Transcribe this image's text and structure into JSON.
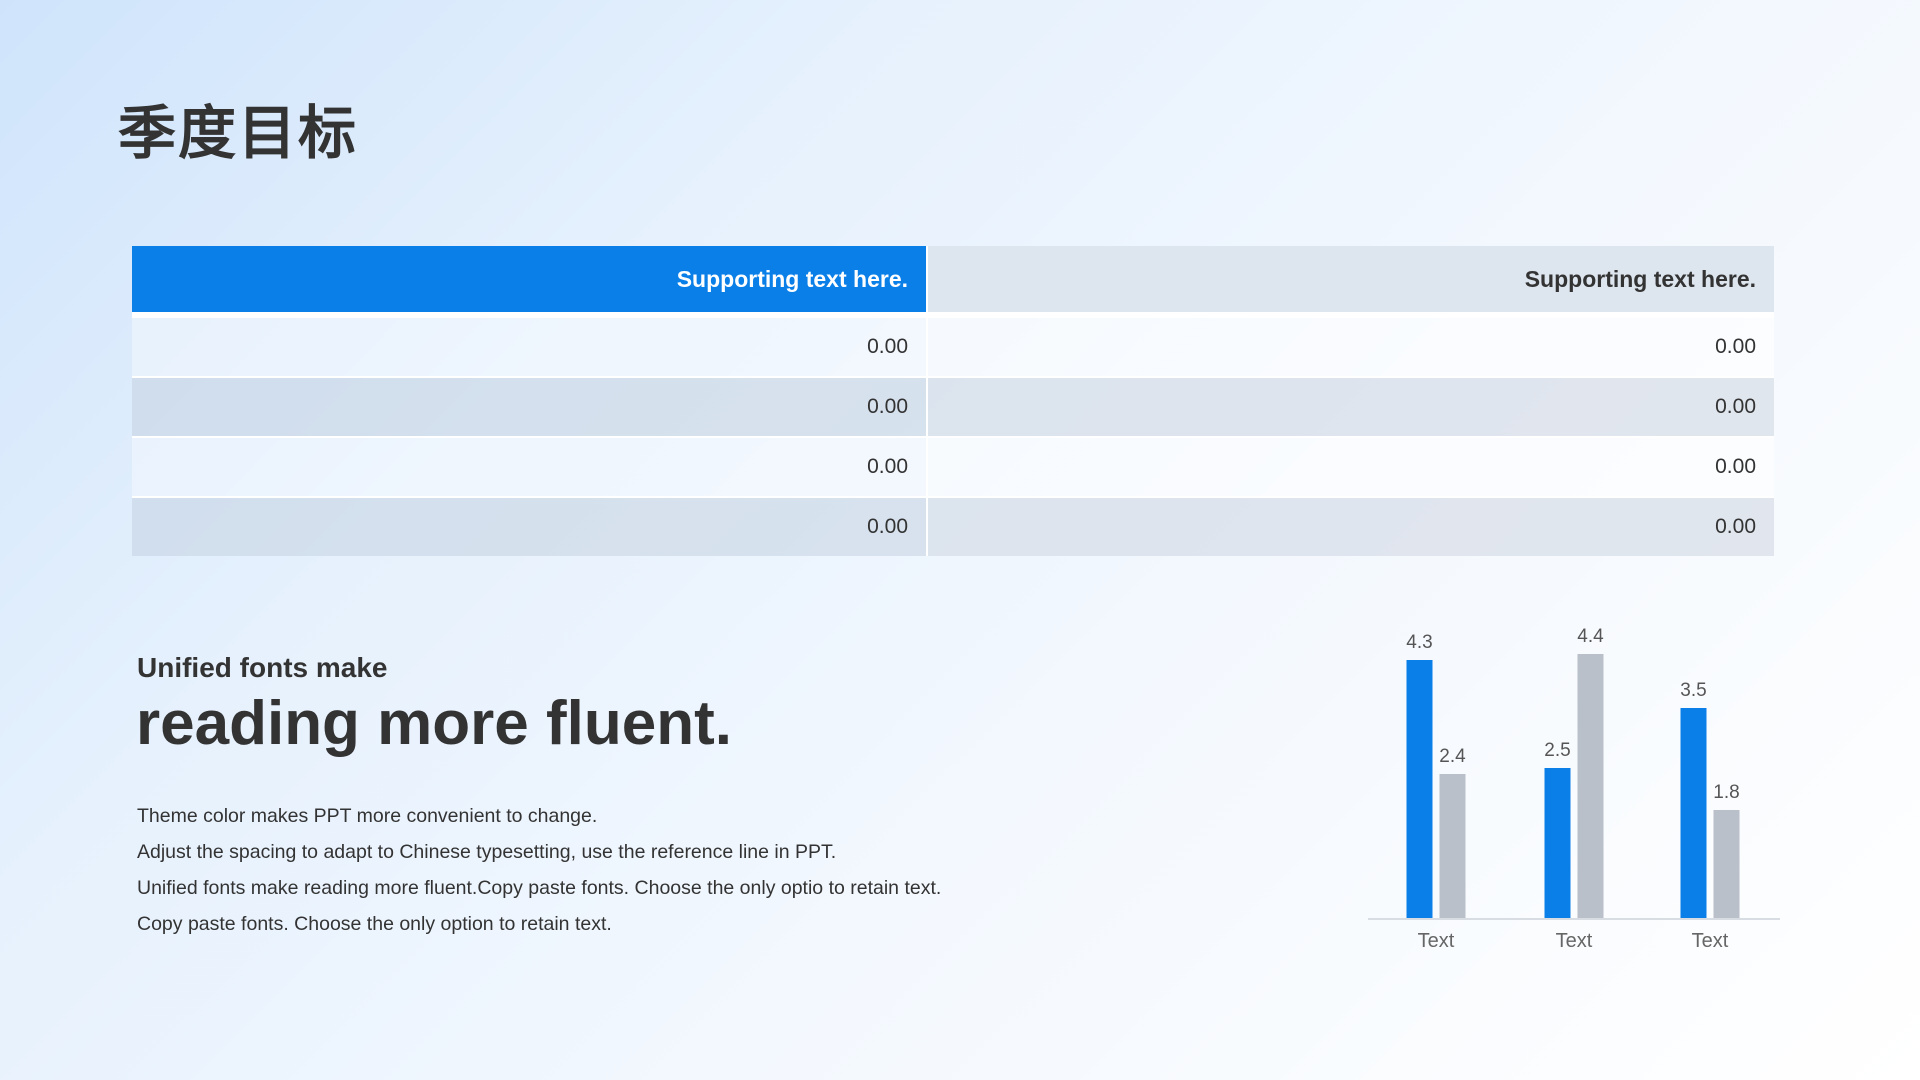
{
  "title": "季度目标",
  "table": {
    "headers": [
      "Supporting text here.",
      "Supporting text here."
    ],
    "rows": [
      [
        "0.00",
        "0.00"
      ],
      [
        "0.00",
        "0.00"
      ],
      [
        "0.00",
        "0.00"
      ],
      [
        "0.00",
        "0.00"
      ]
    ]
  },
  "text_block": {
    "subhead": "Unified fonts make",
    "headline": "reading more fluent.",
    "lines": [
      "Theme  color makes  PPT more convenient  to change.",
      "Adjust  the spacing  to adapt to Chinese  typesetting,  use  the reference line  in  PPT.",
      "Unified  fonts make reading more fluent.Copy paste fonts. Choose the only optio to retain text.",
      "Copy paste  fonts. Choose the only option to retain text."
    ]
  },
  "colors": {
    "accent": "#0a7fe8",
    "secondary": "#b9c0c9"
  },
  "chart_data": {
    "type": "bar",
    "categories": [
      "Text",
      "Text",
      "Text"
    ],
    "series": [
      {
        "values": [
          4.3,
          2.5,
          3.5
        ]
      },
      {
        "values": [
          2.4,
          4.4,
          1.8
        ]
      }
    ],
    "ylim": [
      0,
      4.4
    ],
    "grid": false,
    "legend": "none"
  }
}
